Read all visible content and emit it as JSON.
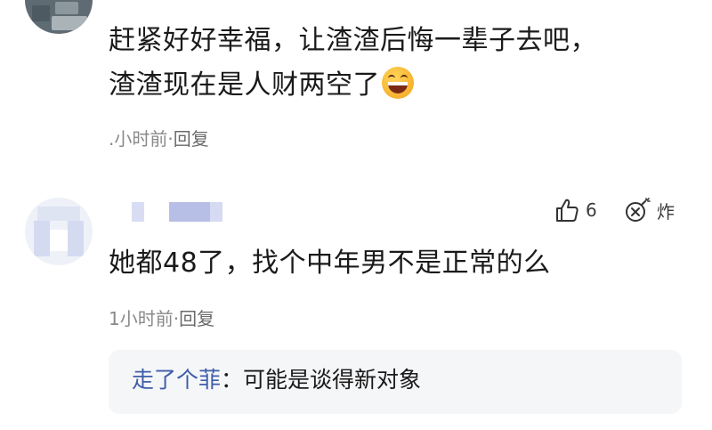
{
  "comment1": {
    "line1": "赶紧好好幸福，让渣渣后悔一辈子去吧，",
    "line2": "渣渣现在是人财两空了",
    "emoji": "grinning-squint-face",
    "time": ".小时前",
    "reply_label": "回复"
  },
  "comment2": {
    "text": "她都48了，找个中年男不是正常的么",
    "time": "1小时前",
    "reply_label": "回复",
    "like_count": "6",
    "bomb_label": "炸",
    "sub_reply": {
      "author": "走了个菲",
      "separator": "：",
      "text": "可能是谈得新对象"
    }
  },
  "colors": {
    "link_blue": "#3f5ea8",
    "meta_gray": "#8a8a8a",
    "reply_bg": "#f5f6f8"
  }
}
